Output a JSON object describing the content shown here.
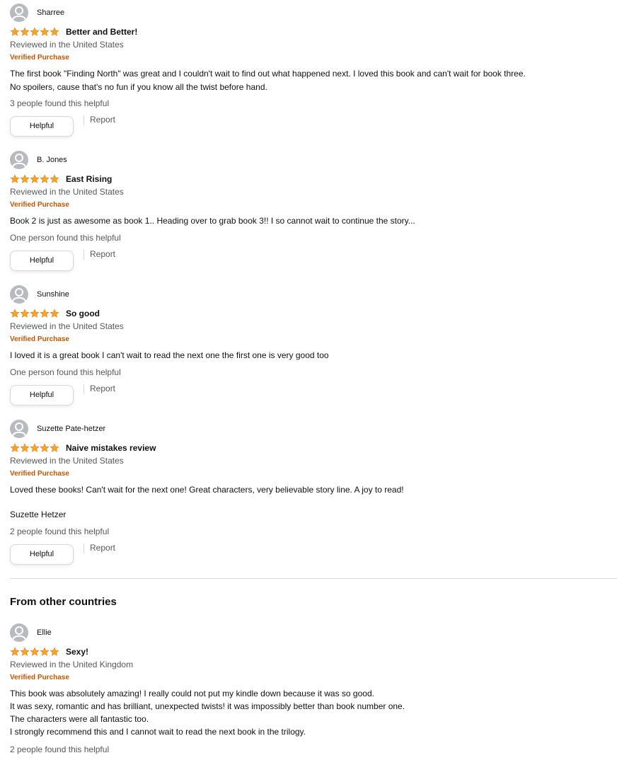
{
  "colors": {
    "star": "#ffa41c",
    "verified": "#c45500",
    "muted": "#565959",
    "avatar": "#b7bbbf",
    "border": "#d5d9d9"
  },
  "icons": {
    "avatar": "default-user-avatar-icon",
    "star": "filled-star-icon"
  },
  "reviews": [
    {
      "author": "Sharree",
      "rating": 5,
      "title": "Better and Better!",
      "date": "Reviewed in the United States",
      "verified": "Verified Purchase",
      "body": [
        "The first book \"Finding North\" was great and I couldn't wait to find out what happened next. I loved this book and can't wait for book three.",
        "No spoilers, cause that's no fun if you know all the twist before hand."
      ],
      "helpful_text": "3 people found this helpful",
      "helpful_label": "Helpful",
      "report_label": "Report"
    },
    {
      "author": "B. Jones",
      "rating": 5,
      "title": "East Rising",
      "date": "Reviewed in the United States",
      "verified": "Verified Purchase",
      "body": [
        "Book 2 is just as awesome as book 1.. Heading over to grab book 3!! I so cannot wait to continue the story..."
      ],
      "helpful_text": "One person found this helpful",
      "helpful_label": "Helpful",
      "report_label": "Report"
    },
    {
      "author": "Sunshine",
      "rating": 5,
      "title": "So good",
      "date": "Reviewed in the United States",
      "verified": "Verified Purchase",
      "body": [
        "I loved it is a great book I can't wait to read the next one the first one is very good too"
      ],
      "helpful_text": "One person found this helpful",
      "helpful_label": "Helpful",
      "report_label": "Report"
    },
    {
      "author": "Suzette Pate-hetzer",
      "rating": 5,
      "title": "Naive mistakes review",
      "date": "Reviewed in the United States",
      "verified": "Verified Purchase",
      "body": [
        "Loved these books! Can't wait for the next one! Great characters, very believable story line. A joy to read!",
        "",
        "Suzette Hetzer"
      ],
      "helpful_text": "2 people found this helpful",
      "helpful_label": "Helpful",
      "report_label": "Report"
    }
  ],
  "other_countries": {
    "heading": "From other countries",
    "reviews": [
      {
        "author": "Ellie",
        "rating": 5,
        "title": "Sexy!",
        "date": "Reviewed in the United Kingdom",
        "verified": "Verified Purchase",
        "body": [
          "This book was absolutely amazing! I really could not put my kindle down because it was so good.",
          "It was sexy, romantic and has brilliant, unexpected twists! it was impossibly better than book number one.",
          "The characters were all fantastic too.",
          "I strongly recommend this and I cannot wait to read the next book in the trilogy."
        ],
        "helpful_text": "2 people found this helpful"
      }
    ]
  }
}
